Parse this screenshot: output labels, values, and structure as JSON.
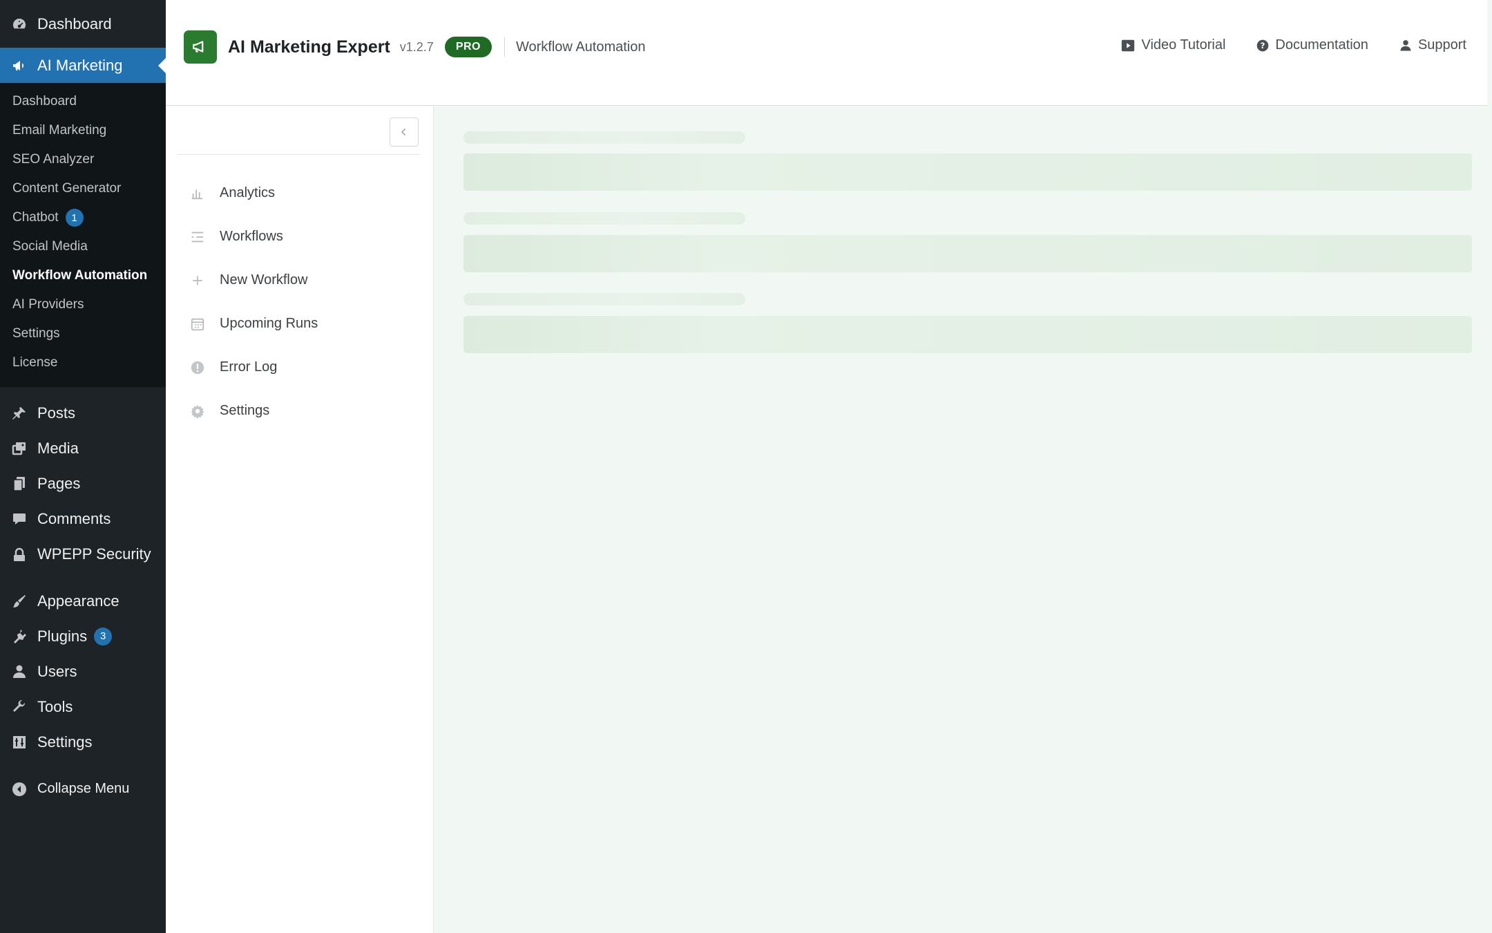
{
  "wp_menu": {
    "dashboard": "Dashboard",
    "ai_marketing": "AI Marketing",
    "submenu": [
      {
        "label": "Dashboard",
        "badge": ""
      },
      {
        "label": "Email Marketing",
        "badge": ""
      },
      {
        "label": "SEO Analyzer",
        "badge": ""
      },
      {
        "label": "Content Generator",
        "badge": ""
      },
      {
        "label": "Chatbot",
        "badge": "1"
      },
      {
        "label": "Social Media",
        "badge": ""
      },
      {
        "label": "Workflow Automation",
        "badge": ""
      },
      {
        "label": "AI Providers",
        "badge": ""
      },
      {
        "label": "Settings",
        "badge": ""
      },
      {
        "label": "License",
        "badge": ""
      }
    ],
    "posts": "Posts",
    "media": "Media",
    "pages": "Pages",
    "comments": "Comments",
    "security": "WPEPP Security",
    "appearance": "Appearance",
    "plugins": "Plugins",
    "plugins_badge": "3",
    "users": "Users",
    "tools": "Tools",
    "settings": "Settings",
    "collapse": "Collapse Menu"
  },
  "header": {
    "title": "AI Marketing Expert",
    "version": "v1.2.7",
    "badge": "PRO",
    "section": "Workflow Automation",
    "links": {
      "video": "Video Tutorial",
      "docs": "Documentation",
      "support": "Support"
    }
  },
  "plugin_nav": {
    "items": [
      {
        "label": "Analytics",
        "icon": "bar-chart-icon"
      },
      {
        "label": "Workflows",
        "icon": "list-icon"
      },
      {
        "label": "New Workflow",
        "icon": "plus-icon"
      },
      {
        "label": "Upcoming Runs",
        "icon": "calendar-icon"
      },
      {
        "label": "Error Log",
        "icon": "alert-icon"
      },
      {
        "label": "Settings",
        "icon": "gear-icon"
      }
    ]
  },
  "colors": {
    "wp_sidebar": "#1d2327",
    "wp_active": "#2271b1",
    "brand_green": "#2a7a2f",
    "content_bg": "#f1f7f2"
  }
}
